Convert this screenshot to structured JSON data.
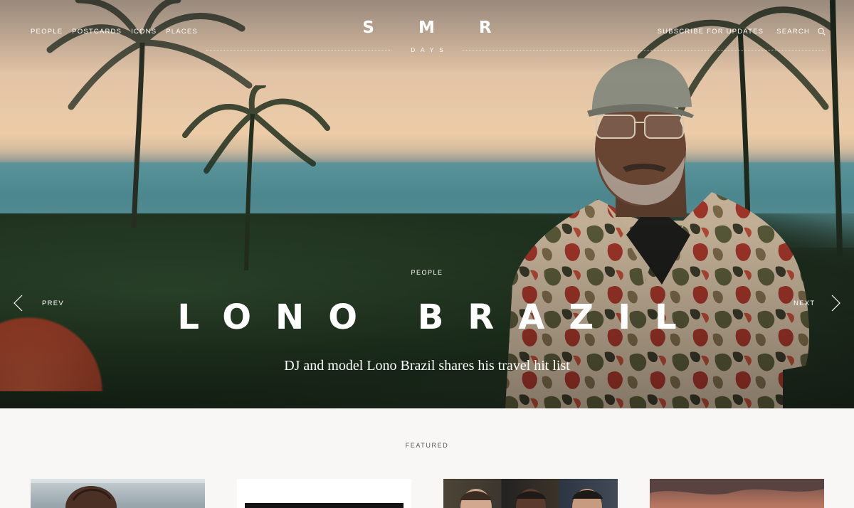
{
  "nav": {
    "left": [
      "PEOPLE",
      "POSTCARDS",
      "ICONS",
      "PLACES"
    ],
    "subscribe": "SUBSCRIBE FOR UPDATES",
    "search": "SEARCH"
  },
  "logo": {
    "main": "SMR",
    "sub": "DAYS"
  },
  "hero": {
    "kicker": "PEOPLE",
    "title": "LONO BRAZIL",
    "subtitle": "DJ and model Lono Brazil shares his travel hit list",
    "prev": "PREV",
    "next": "NEXT"
  },
  "featured": {
    "label": "FEATURED"
  },
  "icons": {
    "search": "search-icon",
    "prev": "chevron-left-icon",
    "next": "chevron-right-icon"
  }
}
